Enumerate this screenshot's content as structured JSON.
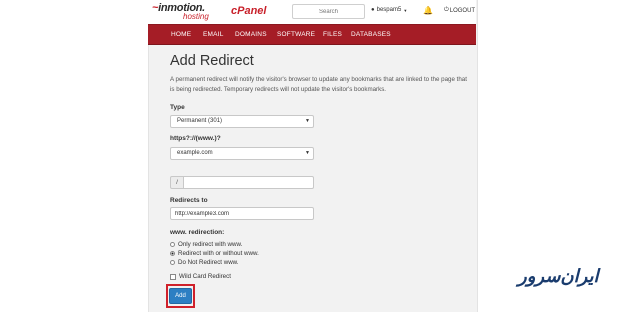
{
  "brand": {
    "logo_main": "inmotion.",
    "logo_sub": "hosting",
    "cpanel": "cPanel"
  },
  "header": {
    "search_placeholder": "Search",
    "username": "bespam5",
    "logout": "LOGOUT"
  },
  "nav": {
    "items": [
      "HOME",
      "EMAIL",
      "DOMAINS",
      "SOFTWARE",
      "FILES",
      "DATABASES"
    ]
  },
  "page": {
    "title": "Add Redirect",
    "description": "A permanent redirect will notify the visitor's browser to update any bookmarks that are linked to the page that is being redirected. Temporary redirects will not update the visitor's bookmarks."
  },
  "form": {
    "type_label": "Type",
    "type_value": "Permanent (301)",
    "domain_label": "https?://(www.)?",
    "domain_value": "example.com",
    "slash": "/",
    "path_value": "",
    "redirects_to_label": "Redirects to",
    "redirects_to_value": "http://example3.com",
    "www_label": "www. redirection:",
    "www_options": [
      "Only redirect with www.",
      "Redirect with or without www.",
      "Do Not Redirect www."
    ],
    "www_selected_index": 1,
    "wildcard_label": "Wild Card Redirect",
    "wildcard_checked": false,
    "add_button": "Add"
  },
  "watermark": "ایران‌سرور",
  "colors": {
    "nav_bg": "#a51d26",
    "brand_red": "#c8202a",
    "button_blue": "#2d7fc3",
    "highlight_border": "#d0212b"
  }
}
